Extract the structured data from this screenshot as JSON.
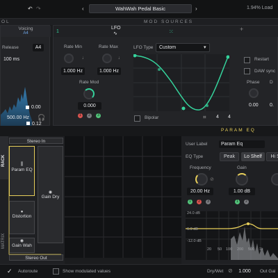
{
  "top": {
    "preset_name": "WahWah Pedal Basic",
    "load_text": "1.94% Load",
    "left_clip": "OL",
    "section_title": "MOD SOURCES"
  },
  "voicing": {
    "title": "Voicing",
    "sub": "A4",
    "release_label": "Release",
    "release_note": "A4",
    "release_value": "100 ms",
    "freq_value": "500.00 Hz",
    "level1": "0.12",
    "level2": "0.00"
  },
  "lfo": {
    "tab_label": "LFO",
    "wave_icon_text": "∿",
    "tab_num": "1",
    "add_label": "+",
    "rate_min_label": "Rate Min",
    "rate_min_value": "1.000 Hz",
    "rate_max_label": "Rate Max",
    "rate_max_value": "1.000 Hz",
    "rate_mod_label": "Rate Mod",
    "rate_mod_value": "0.000",
    "lfo_type_label": "LFO Type",
    "lfo_type_value": "Custom",
    "restart_label": "Restart",
    "daw_sync_label": "DAW sync",
    "phase_label": "Phase",
    "phase_value": "0.00",
    "bipolar_label": "Bipolar",
    "grid_x": "4",
    "grid_y": "4",
    "mod_slots": [
      "1",
      "2",
      "3"
    ],
    "extra_value": "0."
  },
  "rack": {
    "rack_label": "RACK",
    "matrix_label": "MATRIX",
    "stereo_in": "Stereo In",
    "stereo_out": "Stereo Out",
    "param_eq": "Param EQ",
    "gain_dry": "Gain Dry",
    "distortion": "Distortion",
    "gain_wah": "Gain Wah"
  },
  "param_eq": {
    "title": "PARAM EQ",
    "user_label_label": "User Label",
    "user_label_value": "Param Eq",
    "eq_type_label": "EQ Type",
    "eq_types": [
      "Peak",
      "Lo Shelf",
      "Hi Sh"
    ],
    "frequency_label": "Frequency",
    "frequency_value": "20.00 Hz",
    "gain_label": "Gain",
    "gain_value": "1.00 dB",
    "db_ticks": [
      "24.0 dB",
      "6.0 dB",
      "-12.0 dB"
    ],
    "hz_ticks": [
      "20",
      "50",
      "100",
      "200",
      "500",
      "1k"
    ],
    "mod_slots": [
      "1",
      "2",
      "3"
    ]
  },
  "bottom": {
    "autoroute_label": "Autoroute",
    "show_mod_label": "Show modulated values",
    "drywet_label": "Dry/Wet",
    "drywet_value": "1.000",
    "outgain_label": "Out Gai"
  },
  "colors": {
    "accent_green": "#35d39c",
    "accent_yellow": "#e8cf5a",
    "mod_red": "#d9534f",
    "mod_green": "#52c47a"
  }
}
